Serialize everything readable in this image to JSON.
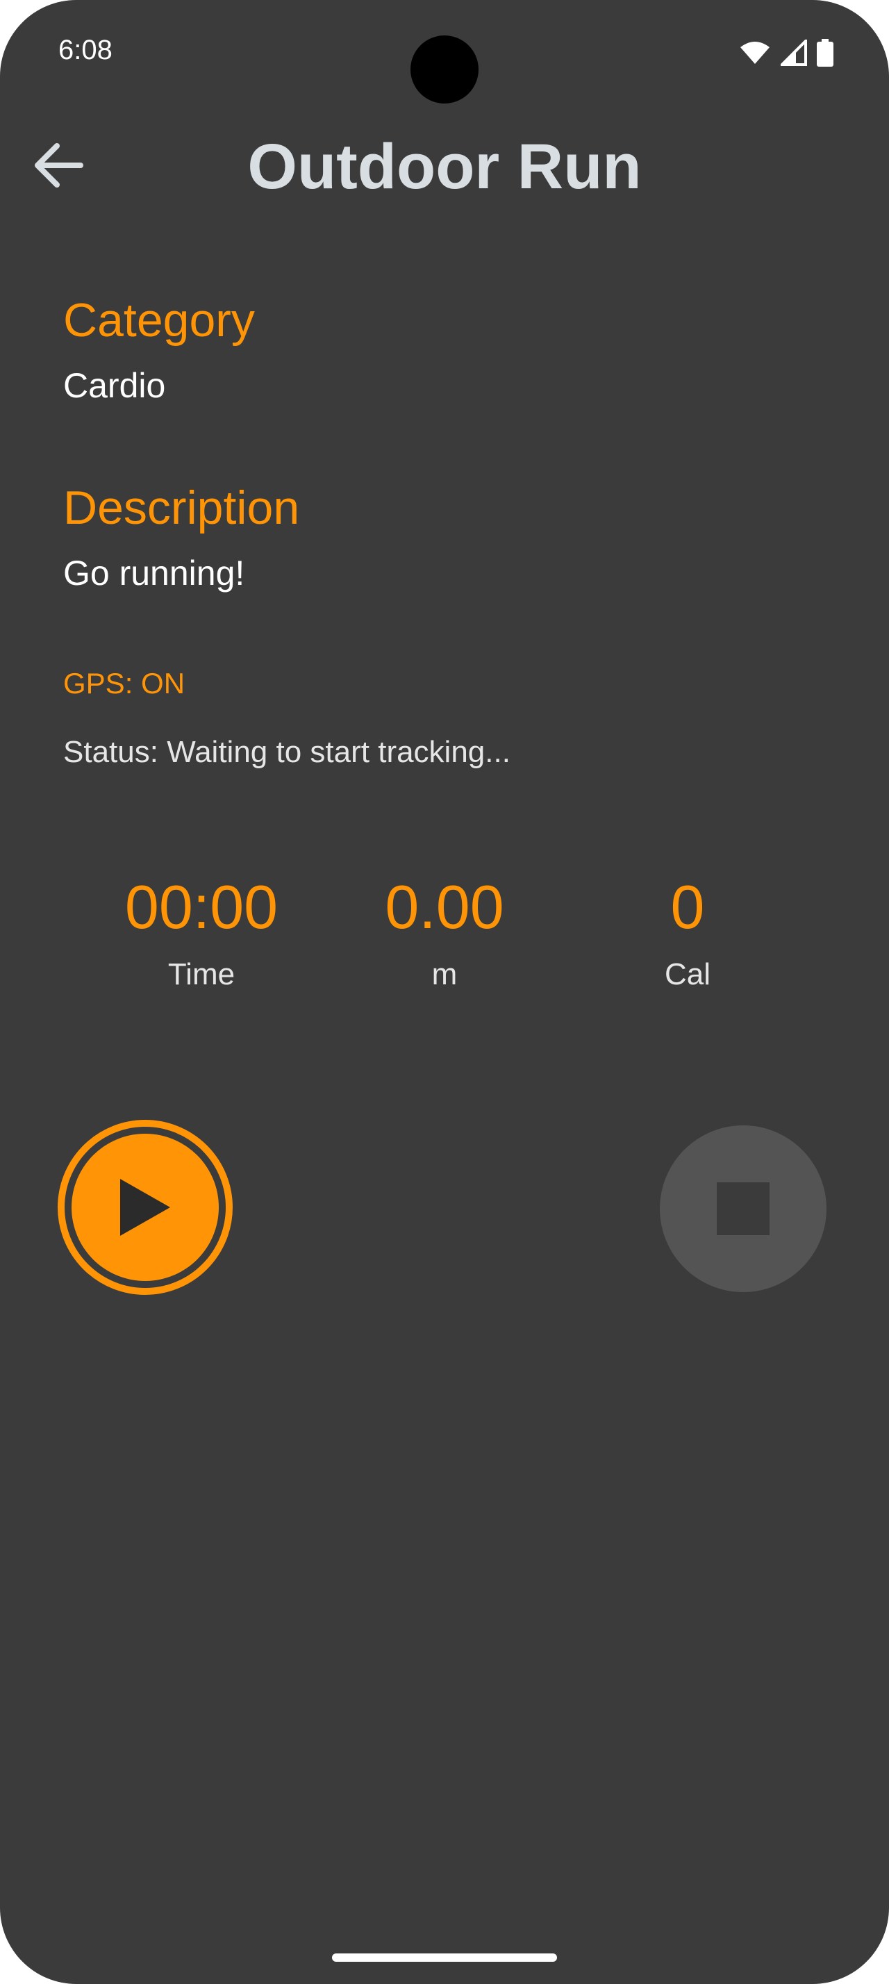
{
  "status_bar": {
    "time": "6:08",
    "icons": [
      "wifi-icon",
      "signal-icon",
      "battery-icon"
    ]
  },
  "header": {
    "title": "Outdoor Run",
    "back_icon": "arrow-left-icon"
  },
  "details": {
    "category_label": "Category",
    "category_value": "Cardio",
    "description_label": "Description",
    "description_value": "Go running!"
  },
  "tracking": {
    "gps": "GPS: ON",
    "status": "Status: Waiting to start tracking..."
  },
  "stats": [
    {
      "value": "00:00",
      "label": "Time"
    },
    {
      "value": "0.00",
      "label": "m"
    },
    {
      "value": "0",
      "label": "Cal"
    }
  ],
  "controls": {
    "play_icon": "play-icon",
    "stop_icon": "stop-icon"
  },
  "colors": {
    "accent": "#ff9406",
    "background": "#3b3b3b",
    "title": "#d9dee2",
    "stop_button": "#545454"
  }
}
